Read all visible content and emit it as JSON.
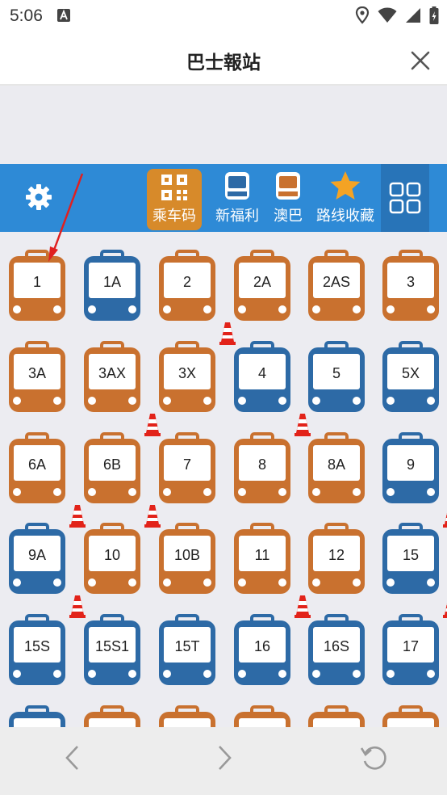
{
  "status_bar": {
    "time": "5:06",
    "icons": [
      "notification-a-icon",
      "location-icon",
      "wifi-icon",
      "signal-icon",
      "battery-icon"
    ]
  },
  "header": {
    "title": "巴士報站",
    "close_icon": "close-icon"
  },
  "toolbar": {
    "settings_icon": "gear-icon",
    "items": [
      {
        "label": "乘车码",
        "icon": "qr-code-icon",
        "active": true
      },
      {
        "label": "新福利",
        "icon": "bus-blue-icon"
      },
      {
        "label": "澳巴",
        "icon": "bus-orange-icon"
      },
      {
        "label": "路线收藏",
        "icon": "star-icon"
      }
    ],
    "grid_icon": "grid-view-icon"
  },
  "routes": [
    {
      "label": "1",
      "color": "orange",
      "cone": false
    },
    {
      "label": "1A",
      "color": "blue",
      "cone": false
    },
    {
      "label": "2",
      "color": "orange",
      "cone": true
    },
    {
      "label": "2A",
      "color": "orange",
      "cone": false
    },
    {
      "label": "2AS",
      "color": "orange",
      "cone": false
    },
    {
      "label": "3",
      "color": "orange",
      "cone": false
    },
    {
      "label": "3A",
      "color": "orange",
      "cone": false
    },
    {
      "label": "3AX",
      "color": "orange",
      "cone": true
    },
    {
      "label": "3X",
      "color": "orange",
      "cone": false
    },
    {
      "label": "4",
      "color": "blue",
      "cone": true
    },
    {
      "label": "5",
      "color": "blue",
      "cone": false
    },
    {
      "label": "5X",
      "color": "blue",
      "cone": false
    },
    {
      "label": "6A",
      "color": "orange",
      "cone": true
    },
    {
      "label": "6B",
      "color": "orange",
      "cone": true
    },
    {
      "label": "7",
      "color": "orange",
      "cone": false
    },
    {
      "label": "8",
      "color": "orange",
      "cone": false
    },
    {
      "label": "8A",
      "color": "orange",
      "cone": false
    },
    {
      "label": "9",
      "color": "blue",
      "cone": true
    },
    {
      "label": "9A",
      "color": "blue",
      "cone": true
    },
    {
      "label": "10",
      "color": "orange",
      "cone": false
    },
    {
      "label": "10B",
      "color": "orange",
      "cone": false
    },
    {
      "label": "11",
      "color": "orange",
      "cone": true
    },
    {
      "label": "12",
      "color": "orange",
      "cone": false
    },
    {
      "label": "15",
      "color": "blue",
      "cone": true
    },
    {
      "label": "15S",
      "color": "blue",
      "cone": false
    },
    {
      "label": "15S1",
      "color": "blue",
      "cone": false
    },
    {
      "label": "15T",
      "color": "blue",
      "cone": false
    },
    {
      "label": "16",
      "color": "blue",
      "cone": false
    },
    {
      "label": "16S",
      "color": "blue",
      "cone": false
    },
    {
      "label": "17",
      "color": "blue",
      "cone": false
    },
    {
      "label": "",
      "color": "blue",
      "cone": false
    },
    {
      "label": "",
      "color": "orange",
      "cone": false
    },
    {
      "label": "",
      "color": "orange",
      "cone": false
    },
    {
      "label": "",
      "color": "orange",
      "cone": false
    },
    {
      "label": "",
      "color": "orange",
      "cone": false
    },
    {
      "label": "",
      "color": "orange",
      "cone": false
    }
  ],
  "colors": {
    "orange": "#c9712f",
    "blue": "#2d6aa6",
    "toolbar": "#2e8ad6",
    "toolbar_active": "#d78a2a",
    "cone": "#e2231a",
    "annotation": "#e02020"
  },
  "bottom_nav": {
    "back_icon": "chevron-left-icon",
    "forward_icon": "chevron-right-icon",
    "reload_icon": "reload-icon"
  }
}
